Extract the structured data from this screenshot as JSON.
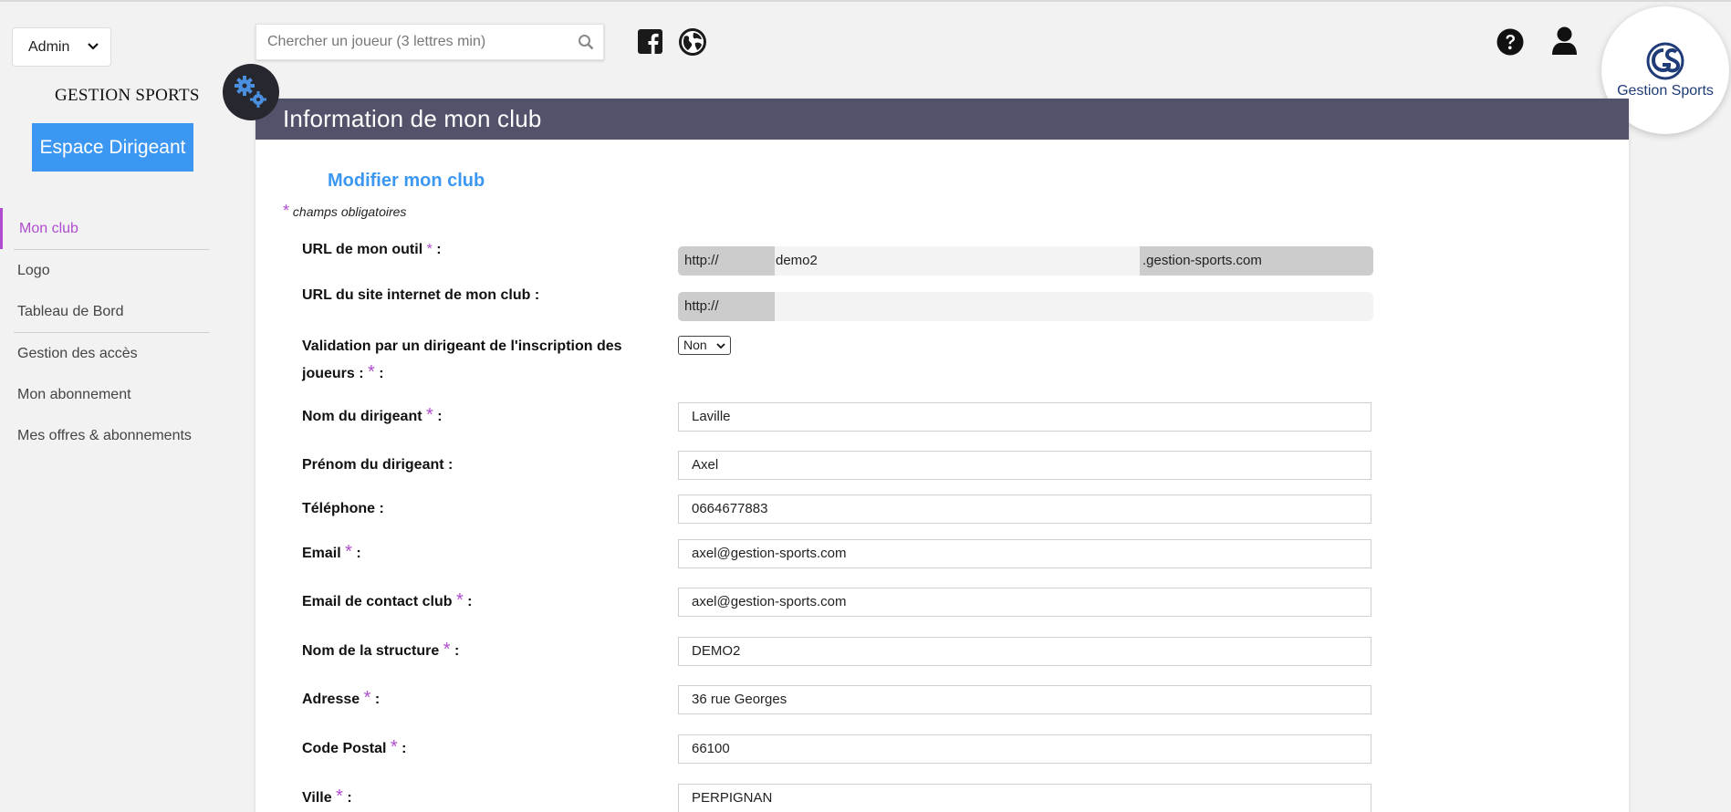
{
  "topbar": {
    "role_select": "Admin",
    "search_placeholder": "Chercher un joueur (3 lettres min)"
  },
  "brand": {
    "name": "GESTION SPORTS",
    "espace_button": "Espace Dirigeant",
    "logo_text": "Gestion Sports",
    "logo_color": "#1f3c78"
  },
  "sidebar": {
    "items": [
      {
        "label": "Mon club",
        "active": true
      },
      {
        "label": "Logo"
      },
      {
        "label": "Tableau de Bord"
      },
      {
        "label": "Gestion des accès"
      },
      {
        "label": "Mon abonnement"
      },
      {
        "label": "Mes offres & abonnements"
      }
    ]
  },
  "main": {
    "header_title": "Information de mon club",
    "subtitle": "Modifier mon club",
    "required_note": "champs obligatoires",
    "star": "*"
  },
  "form": {
    "url_outil": {
      "label": "URL de mon outil",
      "prefix": "http://",
      "value": "demo2",
      "suffix": ".gestion-sports.com"
    },
    "url_site": {
      "label": "URL du site internet de mon club :",
      "prefix": "http://",
      "value": ""
    },
    "validation": {
      "label_line1": "Validation par un dirigeant de l'inscription des",
      "label_line2": "joueurs :",
      "value": "Non"
    },
    "nom": {
      "label": "Nom du dirigeant",
      "value": "Laville"
    },
    "prenom": {
      "label": "Prénom du dirigeant :",
      "value": "Axel"
    },
    "telephone": {
      "label": "Téléphone :",
      "value": "0664677883"
    },
    "email": {
      "label": "Email",
      "value": "axel@gestion-sports.com"
    },
    "email_contact": {
      "label": "Email de contact club",
      "value": "axel@gestion-sports.com"
    },
    "structure": {
      "label": "Nom de la structure",
      "value": "DEMO2"
    },
    "adresse": {
      "label": "Adresse",
      "value": "36 rue Georges"
    },
    "code_postal": {
      "label": "Code Postal",
      "value": "66100"
    },
    "ville": {
      "label": "Ville",
      "value": "PERPIGNAN"
    }
  },
  "colors": {
    "accent_blue": "#3b97f2",
    "required_purple": "#b04cd0",
    "header_bg": "#52526a"
  }
}
